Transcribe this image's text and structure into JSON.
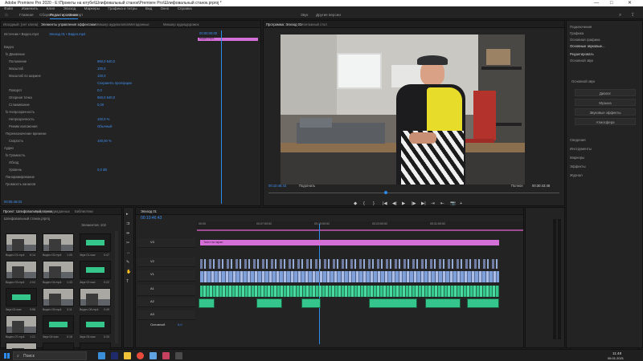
{
  "window": {
    "title": "Adobe Premiere Pro 2020 - E:\\Проекты на ютубе\\Шлифовальный станок\\Premiere Pro\\Шлифовальный станок.prproj *",
    "minimize": "—",
    "maximize": "□",
    "close": "✕"
  },
  "menu": [
    "Файл",
    "Изменить",
    "Клип",
    "Эпизод",
    "Маркеры",
    "Графика и титры",
    "Вид",
    "Окно",
    "Справка"
  ],
  "workspaces": {
    "home": "Главная",
    "items": [
      "Сборка",
      "Редактирование",
      "Экспорт"
    ],
    "active": "Редактирование",
    "right": [
      "Звук",
      "Другие версии"
    ]
  },
  "effect_controls": {
    "tabs": [
      "Исходный: (нет клипа)",
      "Элементы управления эффектами",
      "Микшер аудиоклипов",
      "Метаданные",
      "Микшер аудиодорожек"
    ],
    "active_tab": "Элементы управления эффектами",
    "clip_path": "Источник • Видео.mp4",
    "sequence_label": "Эпизод 01 • Видео.mp4",
    "clip_bar_label": "Видео.mp4",
    "timecode": "00:00:00:00",
    "rows": [
      {
        "label": "Видео",
        "value": ""
      },
      {
        "label": "fx Движение",
        "value": ""
      },
      {
        "label": "Положение",
        "value": "960,0   540,0"
      },
      {
        "label": "Масштаб",
        "value": "100,0"
      },
      {
        "label": "Масштаб по ширине",
        "value": "100,0"
      },
      {
        "label": "",
        "value": "Сохранять пропорции"
      },
      {
        "label": "Поворот",
        "value": "0,0"
      },
      {
        "label": "Опорная точка",
        "value": "960,0   540,0"
      },
      {
        "label": "Сглаживание",
        "value": "0,00"
      },
      {
        "label": "fx Непрозрачность",
        "value": ""
      },
      {
        "label": "Непрозрачность",
        "value": "100,0 %"
      },
      {
        "label": "Режим наложения",
        "value": "Обычный"
      },
      {
        "label": "Переназначение времени",
        "value": ""
      },
      {
        "label": "Скорость",
        "value": "100,00 %"
      },
      {
        "label": "Аудио",
        "value": ""
      },
      {
        "label": "fx Громкость",
        "value": ""
      },
      {
        "label": "Обход",
        "value": ""
      },
      {
        "label": "Уровень",
        "value": "0,0 dB"
      },
      {
        "label": "Панорамирование",
        "value": ""
      },
      {
        "label": "Громкость каналов",
        "value": ""
      }
    ],
    "bottom_timecode": "00:05:46:03"
  },
  "program": {
    "tabs": [
      "Программа: Эпизод 01",
      "Монтажный стол"
    ],
    "timecode": "00:10:46:43",
    "fit": "Подогнать",
    "quality": "Полное",
    "duration": "00:30:43:48",
    "controls": [
      "◆",
      "{",
      "}",
      "|◀",
      "◀|",
      "▶",
      "|▶",
      "▶|",
      "⇥",
      "⇤",
      "📷",
      "+"
    ]
  },
  "right_panel": {
    "items": [
      "Подключения",
      "Графика",
      "Основная графика",
      "Основные звуковые..."
    ],
    "section": "Редактировать",
    "subsection": "Основной звук",
    "actions": [
      "Диалог",
      "Музыка",
      "Звуковые эффекты",
      "Атмосфера"
    ],
    "lower": [
      "Сведения",
      "Инструменты",
      "Маркеры",
      "Эффекты",
      "Журнал"
    ]
  },
  "project": {
    "tabs": [
      "Проект: Шлифовальный станок",
      "Браузер медиаданных",
      "Библиотеки"
    ],
    "file": "Шлифовальный станок.prproj",
    "count": "Элементов: 102",
    "thumbs": [
      {
        "label": "Видео 01.mp4",
        "dur": "6:14",
        "audio": false
      },
      {
        "label": "Видео 02.mp4",
        "dur": "1:05",
        "audio": false
      },
      {
        "label": "Звук 01.wav",
        "dur": "0:47",
        "audio": true
      },
      {
        "label": "Видео 03.mp4",
        "dur": "2:04",
        "audio": false
      },
      {
        "label": "Видео 04.mp4",
        "dur": "1:33",
        "audio": false
      },
      {
        "label": "Звук 02.wav",
        "dur": "0:22",
        "audio": true
      },
      {
        "label": "Звук 03.wav",
        "dur": "0:56",
        "audio": true
      },
      {
        "label": "Видео 05.mp4",
        "dur": "3:11",
        "audio": false
      },
      {
        "label": "Видео 06.mp4",
        "dur": "0:49",
        "audio": false
      },
      {
        "label": "Видео 07.mp4",
        "dur": "1:21",
        "audio": false
      },
      {
        "label": "Звук 04.wav",
        "dur": "0:18",
        "audio": true
      },
      {
        "label": "Звук 05.wav",
        "dur": "0:33",
        "audio": true
      },
      {
        "label": "Видео 08.mp4",
        "dur": "2:42",
        "audio": false
      },
      {
        "label": "Звук 06.wav",
        "dur": "0:41",
        "audio": true
      },
      {
        "label": "Звук 07.wav",
        "dur": "0:29",
        "audio": true
      }
    ]
  },
  "timeline": {
    "tab": "Эпизод 01",
    "timecode": "00:10:46:43",
    "ruler": [
      "00:00",
      "00:07:59:52",
      "00:15:59:52",
      "00:23:59:52",
      "00:31:59:52"
    ],
    "title_clip": "Текст на экран",
    "video_tracks": [
      "V3",
      "V2",
      "V1"
    ],
    "audio_tracks": [
      "A1",
      "A2",
      "A3"
    ],
    "master": "Основной",
    "master_value": "0,0"
  },
  "taskbar": {
    "search": "Поиск",
    "time": "11:48",
    "date": "06.01.2021"
  },
  "colors": {
    "accent": "#2d8ceb",
    "title_clip": "#d56fd8",
    "video_clip": "#7fa0d9",
    "audio_clip": "#35c68b"
  }
}
